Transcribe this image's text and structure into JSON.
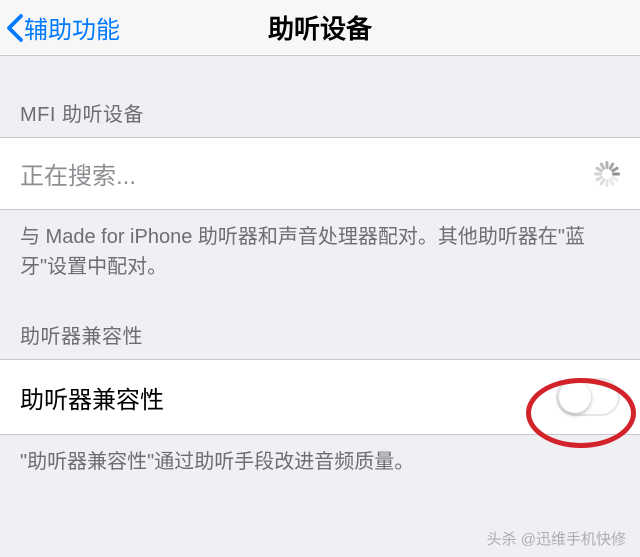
{
  "nav": {
    "back_label": "辅助功能",
    "title": "助听设备"
  },
  "section1": {
    "header": "MFI 助听设备",
    "searching_label": "正在搜索...",
    "footer": "与 Made for iPhone 助听器和声音处理器配对。其他助听器在\"蓝牙\"设置中配对。"
  },
  "section2": {
    "header": "助听器兼容性",
    "row_label": "助听器兼容性",
    "switch_on": false,
    "footer": "\"助听器兼容性\"通过助听手段改进音频质量。"
  },
  "watermark": "头杀 @迅维手机快修"
}
